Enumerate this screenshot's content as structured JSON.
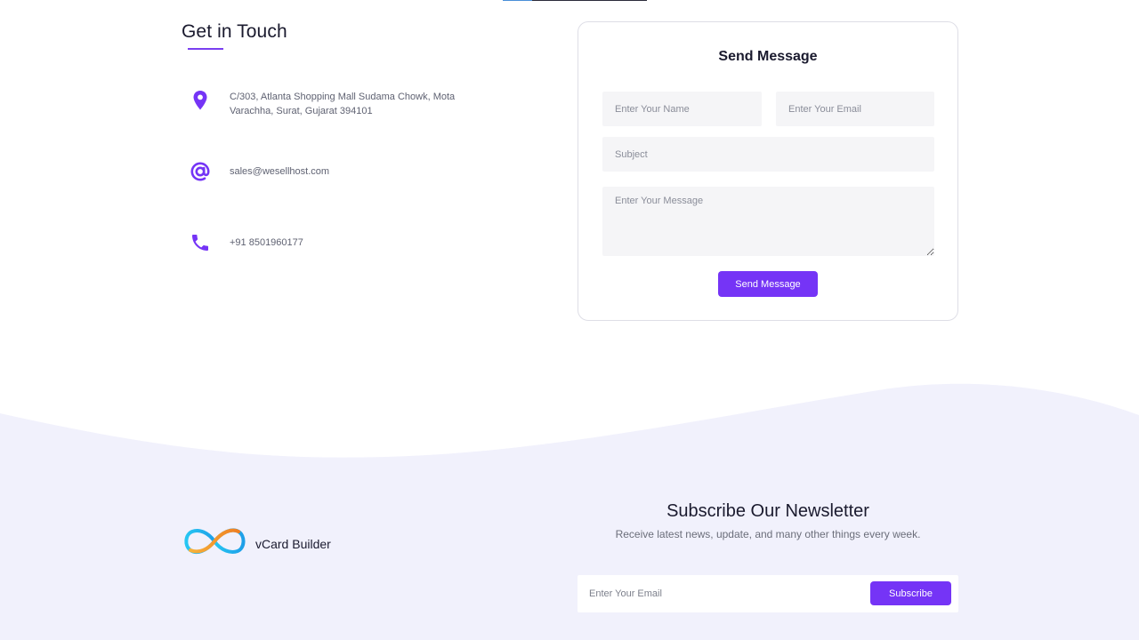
{
  "contact": {
    "heading": "Get in Touch",
    "address": "C/303, Atlanta Shopping Mall Sudama Chowk, Mota Varachha, Surat, Gujarat 394101",
    "email": "sales@wesellhost.com",
    "phone": "+91 8501960177",
    "icons": {
      "address": "location-pin-icon",
      "email": "at-sign-icon",
      "phone": "phone-icon"
    }
  },
  "form": {
    "heading": "Send Message",
    "name_placeholder": "Enter Your Name",
    "email_placeholder": "Enter Your Email",
    "subject_placeholder": "Subject",
    "message_placeholder": "Enter Your Message",
    "submit_label": "Send Message"
  },
  "footer": {
    "brand_name": "vCard Builder",
    "newsletter_heading": "Subscribe Our Newsletter",
    "newsletter_text": "Receive latest news, update, and many other things every week.",
    "newsletter_email_placeholder": "Enter Your Email",
    "subscribe_label": "Subscribe"
  },
  "colors": {
    "accent": "#7534f6",
    "footer_bg": "#f1f1fc",
    "field_bg": "#f5f5f7"
  }
}
